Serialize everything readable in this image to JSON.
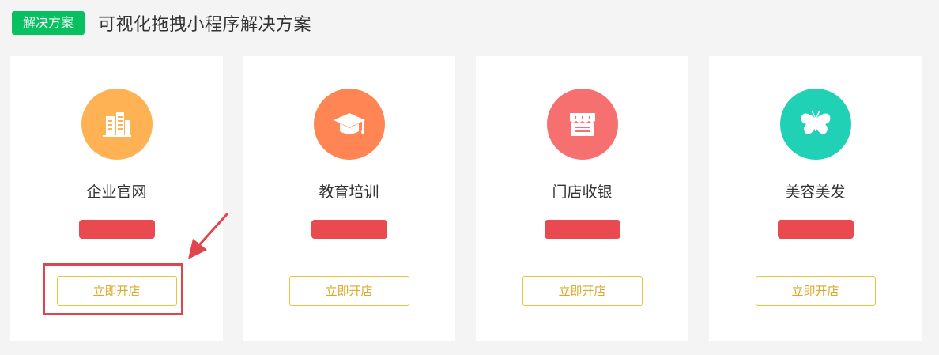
{
  "header": {
    "badge": "解决方案",
    "title": "可视化拖拽小程序解决方案"
  },
  "colors": {
    "badge_green": "#07c160",
    "highlight_red": "#e0454d",
    "button_border": "#e8c53a",
    "button_text": "#d9a92a",
    "redacted_bar": "#e84a4f"
  },
  "cards": [
    {
      "title": "企业官网",
      "icon": "building-icon",
      "icon_color": "#ffb253",
      "button": "立即开店",
      "highlighted": true
    },
    {
      "title": "教育培训",
      "icon": "graduation-cap-icon",
      "icon_color": "#ff8654",
      "button": "立即开店",
      "highlighted": false
    },
    {
      "title": "门店收银",
      "icon": "storefront-icon",
      "icon_color": "#f5706f",
      "button": "立即开店",
      "highlighted": false
    },
    {
      "title": "美容美发",
      "icon": "butterfly-icon",
      "icon_color": "#20d1b5",
      "button": "立即开店",
      "highlighted": false
    }
  ]
}
